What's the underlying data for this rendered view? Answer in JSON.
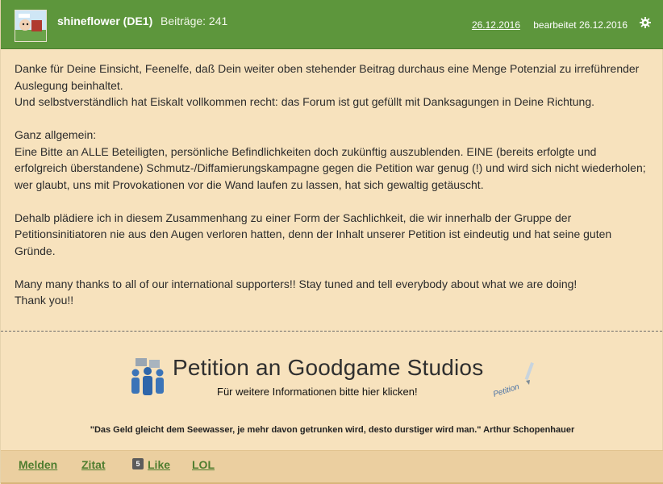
{
  "header": {
    "username": "shineflower (DE1)",
    "posts_label": "Beiträge: 241",
    "date": "26.12.2016",
    "edited": "bearbeitet 26.12.2016",
    "settings_icon": "gear-icon",
    "colors": {
      "bar": "#5d963c",
      "text": "#ffffff"
    }
  },
  "post": {
    "paragraphs": [
      "Danke für Deine Einsicht, Feenelfe, daß Dein weiter oben stehender Beitrag durchaus eine Menge Potenzial zu irreführender Auslegung beinhaltet.",
      "Und selbstverständlich hat Eiskalt vollkommen recht: das Forum ist gut gefüllt mit Danksagungen in Deine Richtung.",
      "Ganz allgemein:",
      "Eine Bitte an ALLE Beteiligten, persönliche Befindlichkeiten doch zukünftig auszublenden. EINE (bereits erfolgte und erfolgreich überstandene) Schmutz-/Diffamierungskampagne gegen die Petition war genug (!) und wird sich nicht wiederholen; wer glaubt, uns mit Provokationen vor die Wand laufen zu lassen, hat sich gewaltig getäuscht.",
      "Dehalb plädiere ich in diesem Zusammenhang zu einer Form der Sachlichkeit, die wir innerhalb der Gruppe der Petitionsinitiatoren nie aus den Augen verloren hatten, denn der Inhalt unserer Petition ist eindeutig und hat seine guten Gründe.",
      "Many many thanks to all of our international supporters!! Stay tuned and tell everybody about what we are doing!",
      "Thank you!!"
    ]
  },
  "banner": {
    "title": "Petition an Goodgame Studios",
    "subtitle": "Für weitere Informationen bitte hier klicken!",
    "stamp": "Petition"
  },
  "signature": {
    "quote": "\"Das Geld gleicht dem Seewasser, je mehr davon getrunken wird, desto durstiger wird man.\" Arthur Schopenhauer"
  },
  "footer": {
    "report": "Melden",
    "quote": "Zitat",
    "like_count": "5",
    "like": "Like",
    "lol": "LOL"
  }
}
